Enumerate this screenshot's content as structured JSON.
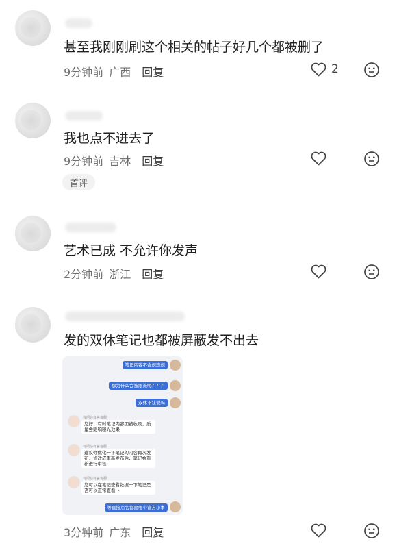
{
  "comments": [
    {
      "text": "甚至我刚刚刷这个相关的帖子好几个都被删了",
      "time": "9分钟前",
      "location": "广西",
      "reply": "回复",
      "likes": "2"
    },
    {
      "text": "我也点不进去了",
      "time": "9分钟前",
      "location": "吉林",
      "reply": "回复",
      "badge": "首评"
    },
    {
      "text": "艺术已成 不允许你发声",
      "time": "2分钟前",
      "location": "浙江",
      "reply": "回复"
    },
    {
      "text": "发的双休笔记也都被屏蔽发不出去",
      "time": "3分钟前",
      "location": "广东",
      "reply": "回复"
    }
  ],
  "chat": {
    "messages": [
      "笔记内容不合规违规",
      "那为什么会被限流呢？？？",
      "双休不让说吗",
      "您好，有时笔记内容因被收录，质量会影响曝光效果",
      "建议你优化一下笔记的内容再次发布，修改成重新发布后，笔记会重新进行审核",
      "您可以在笔记查看数据一下笔记是否可以正常查看～",
      "等直接点名都是哪个官方小事"
    ],
    "agent_label": "有问必有答客服"
  },
  "colors": {
    "bubble_blue": "#3b6fd6",
    "text": "#1f1f1f",
    "meta": "#6f6f6f"
  }
}
